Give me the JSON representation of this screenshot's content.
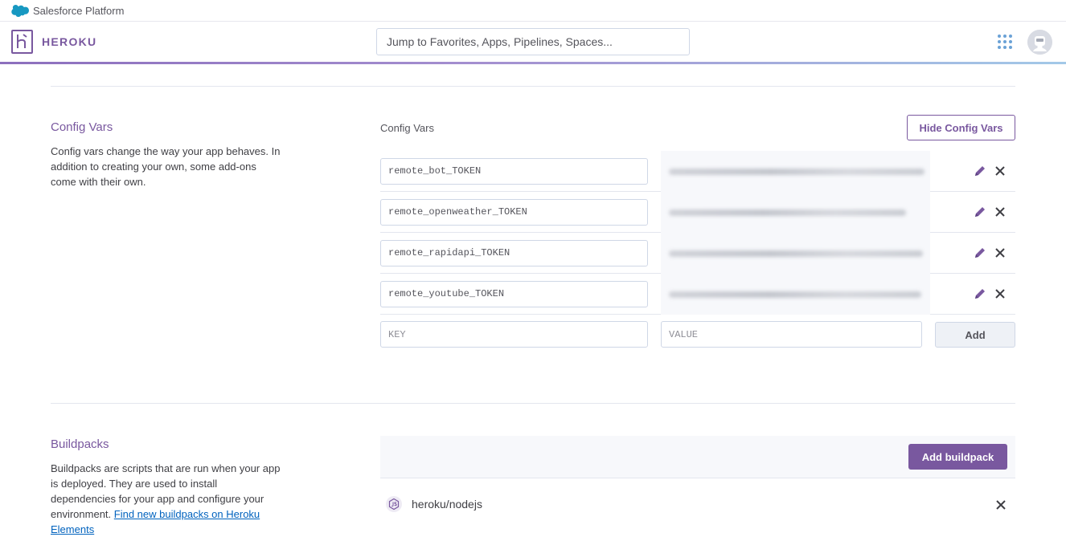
{
  "salesforce": {
    "label": "Salesforce Platform",
    "cloud_icon": "salesforce-cloud-icon",
    "cloud_color": "#1798c1"
  },
  "header": {
    "brand": "HEROKU",
    "brand_color": "#79589f",
    "search_placeholder": "Jump to Favorites, Apps, Pipelines, Spaces...",
    "apps_icon": "apps-grid-icon",
    "avatar_icon": "user-avatar-icon"
  },
  "config_vars": {
    "section_title": "Config Vars",
    "section_description": "Config vars change the way your app behaves. In addition to creating your own, some add-ons come with their own.",
    "panel_label": "Config Vars",
    "toggle_button": "Hide Config Vars",
    "vars": [
      {
        "key": "remote_bot_TOKEN"
      },
      {
        "key": "remote_openweather_TOKEN"
      },
      {
        "key": "remote_rapidapi_TOKEN"
      },
      {
        "key": "remote_youtube_TOKEN"
      }
    ],
    "new_key_placeholder": "KEY",
    "new_value_placeholder": "VALUE",
    "add_button": "Add"
  },
  "buildpacks": {
    "section_title": "Buildpacks",
    "section_description": "Buildpacks are scripts that are run when your app is deployed. They are used to install dependencies for your app and configure your environment.",
    "link_text": "Find new buildpacks on Heroku Elements",
    "add_button": "Add buildpack",
    "items": [
      {
        "name": "heroku/nodejs",
        "icon": "nodejs-icon"
      }
    ]
  }
}
